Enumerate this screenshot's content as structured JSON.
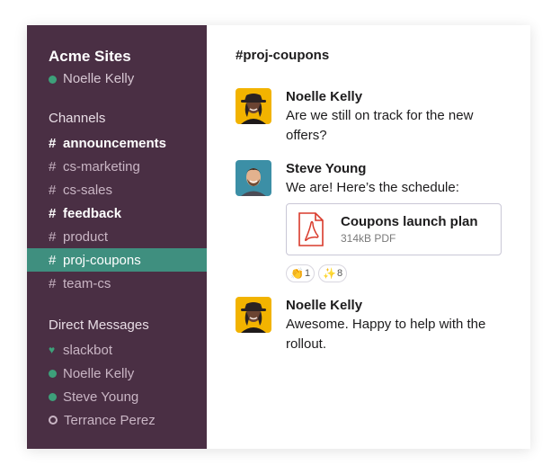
{
  "workspace": {
    "name": "Acme Sites",
    "current_user": "Noelle Kelly"
  },
  "sidebar": {
    "channels_title": "Channels",
    "channels": [
      {
        "name": "announcements",
        "bold": true,
        "active": false
      },
      {
        "name": "cs-marketing",
        "bold": false,
        "active": false
      },
      {
        "name": "cs-sales",
        "bold": false,
        "active": false
      },
      {
        "name": "feedback",
        "bold": true,
        "active": false
      },
      {
        "name": "product",
        "bold": false,
        "active": false
      },
      {
        "name": "proj-coupons",
        "bold": false,
        "active": true
      },
      {
        "name": "team-cs",
        "bold": false,
        "active": false
      }
    ],
    "hash": "#",
    "dm_title": "Direct Messages",
    "dms": [
      {
        "name": "slackbot",
        "status": "heart-icon"
      },
      {
        "name": "Noelle Kelly",
        "status": "online"
      },
      {
        "name": "Steve Young",
        "status": "online"
      },
      {
        "name": "Terrance Perez",
        "status": "away"
      }
    ]
  },
  "main": {
    "channel_header": "#proj-coupons",
    "messages": [
      {
        "author": "Noelle Kelly",
        "text": "Are we still on track for the new offers?"
      },
      {
        "author": "Steve Young",
        "text": "We are! Here’s the schedule:",
        "attachment": {
          "name": "Coupons launch plan",
          "meta": "314kB PDF"
        },
        "reactions": [
          {
            "emoji": "👏",
            "count": "1"
          },
          {
            "emoji": "✨",
            "count": "8"
          }
        ]
      },
      {
        "author": "Noelle Kelly",
        "text": "Awesome. Happy to help with the rollout."
      }
    ]
  },
  "colors": {
    "sidebar_bg": "#4a2f44",
    "active_channel": "#3f8f7f",
    "online": "#3da07a",
    "pdf_red": "#d93a2b"
  }
}
